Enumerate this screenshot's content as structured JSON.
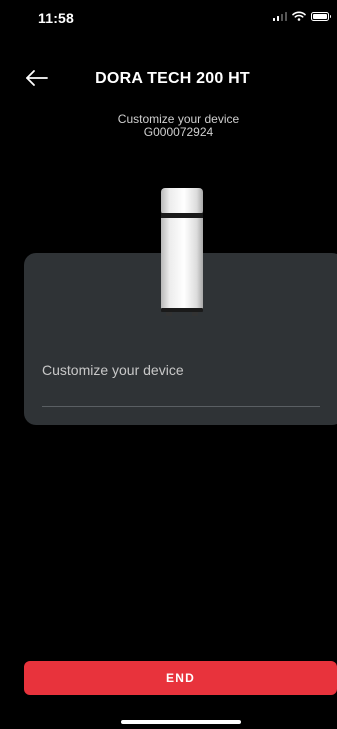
{
  "status_bar": {
    "time": "11:58"
  },
  "header": {
    "title": "DORA TECH 200 HT"
  },
  "device": {
    "subtitle": "Customize your device",
    "serial": "G000072924"
  },
  "form": {
    "label": "Customize your device",
    "value": ""
  },
  "actions": {
    "end_label": "END"
  },
  "colors": {
    "background": "#000000",
    "card": "#2f3336",
    "accent": "#e8333c"
  }
}
